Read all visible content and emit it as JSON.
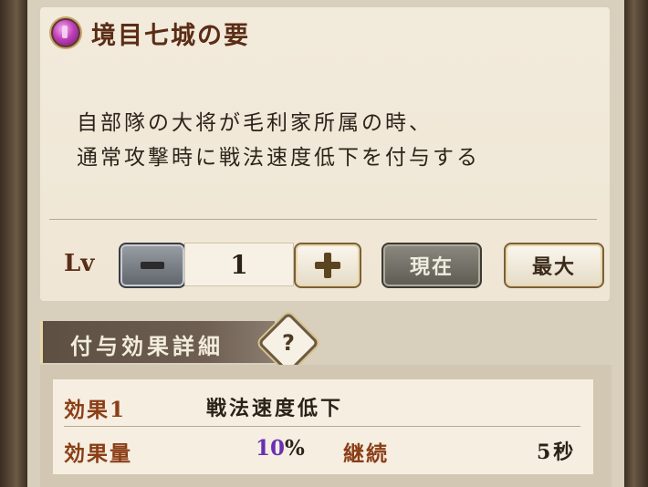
{
  "skill": {
    "icon": "gem-icon",
    "icon_color": "#c140b9",
    "title": "境目七城の要",
    "description_lines": [
      "自部隊の大将が毛利家所属の時、",
      "通常攻撃時に戦法速度低下を付与する"
    ]
  },
  "level": {
    "label": "Lv",
    "value": "1",
    "minus_icon": "minus-icon",
    "plus_icon": "plus-icon",
    "current_label": "現在",
    "max_label": "最大"
  },
  "effect_details": {
    "header": "付与効果詳細",
    "help_icon": "?",
    "effect_label": "効果1",
    "effect_name": "戦法速度低下",
    "amount_label": "効果量",
    "amount_value": "10",
    "amount_unit": "%",
    "duration_label": "継続",
    "duration_value": "5秒"
  },
  "colors": {
    "amount_value": "#6a2fb3",
    "title": "#5b2d16",
    "labels": "#8b3e16"
  }
}
